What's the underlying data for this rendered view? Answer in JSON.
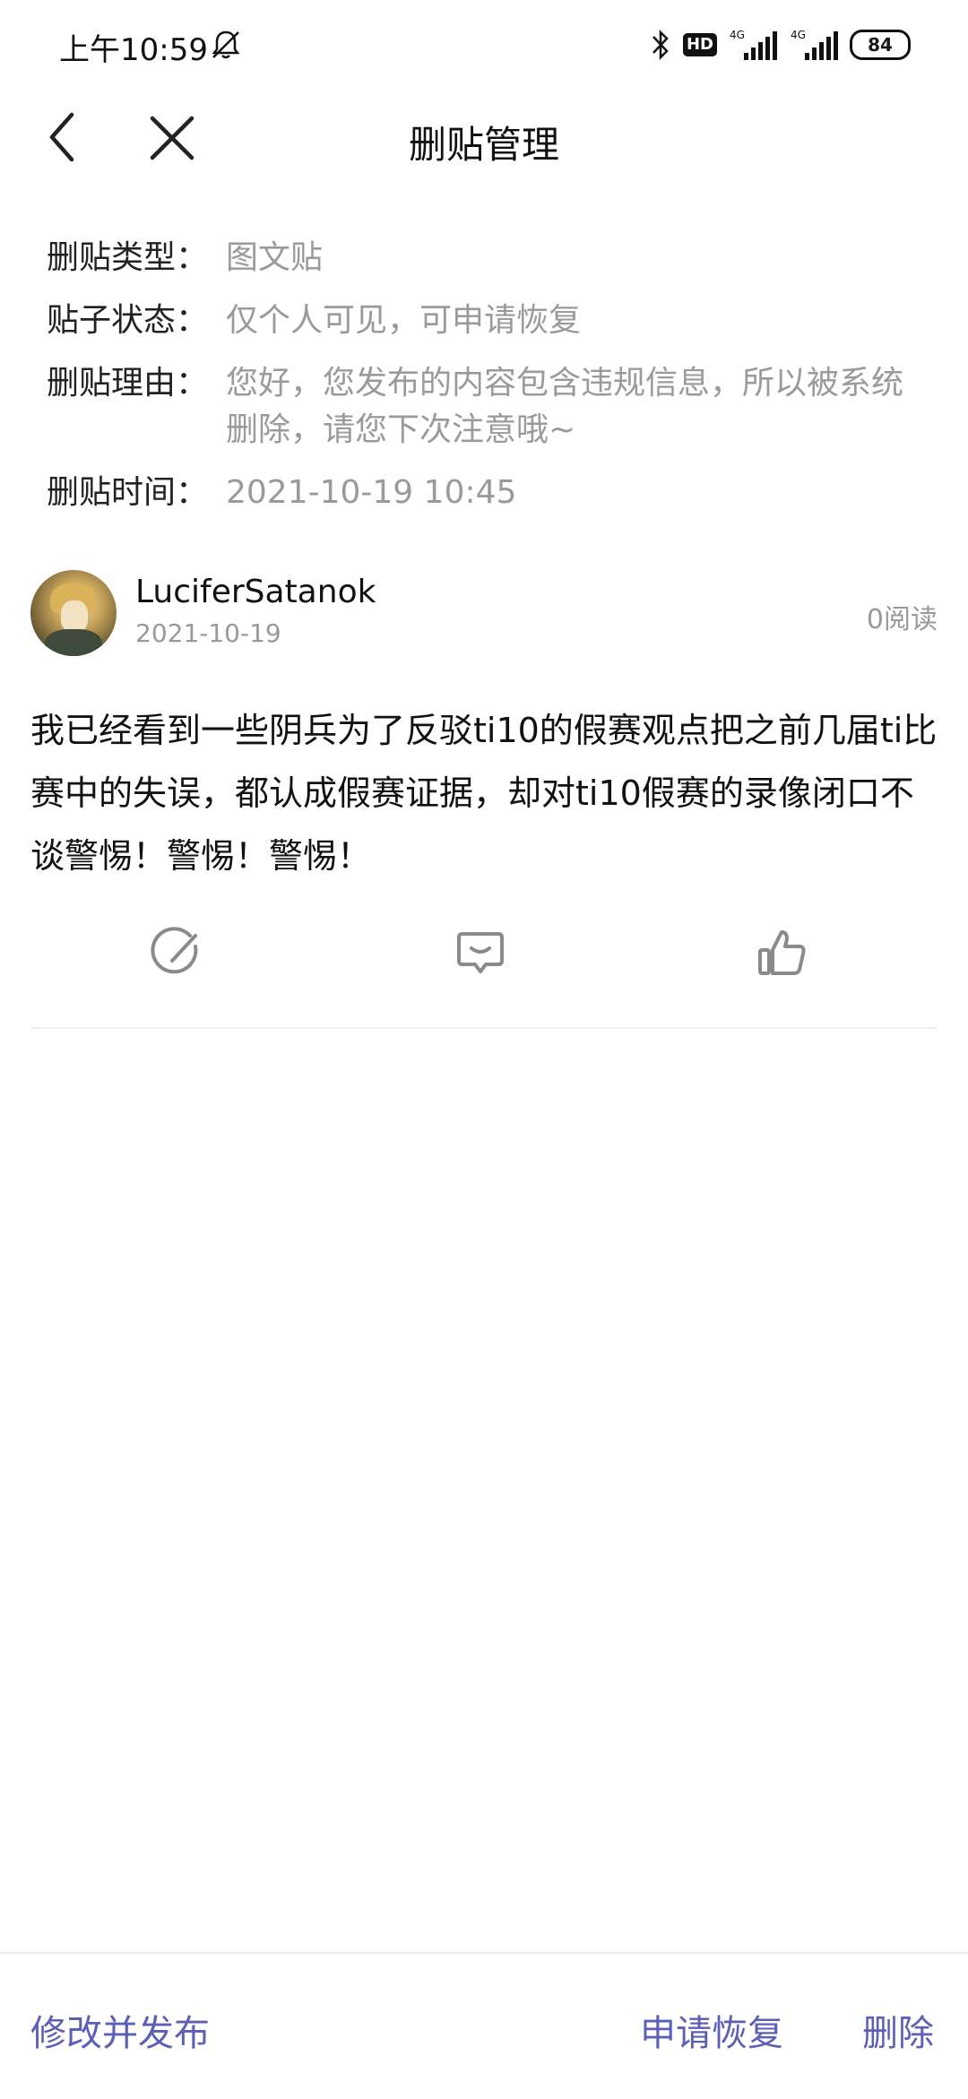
{
  "status_bar": {
    "time": "上午10:59",
    "hd_label": "HD",
    "network_1": "4G",
    "network_2": "4G",
    "battery": "84"
  },
  "navbar": {
    "title": "删贴管理",
    "back_icon": "chevron-left",
    "close_icon": "close-x"
  },
  "info": {
    "rows": [
      {
        "label": "删贴类型：",
        "value": "图文贴"
      },
      {
        "label": "贴子状态：",
        "value": "仅个人可见，可申请恢复"
      },
      {
        "label": "删贴理由：",
        "value": "您好，您发布的内容包含违规信息，所以被系统删除，请您下次注意哦~"
      },
      {
        "label": "删贴时间：",
        "value": "2021-10-19 10:45"
      }
    ]
  },
  "post": {
    "username": "LuciferSatanok",
    "date": "2021-10-19",
    "read_count": "0阅读",
    "content": "我已经看到一些阴兵为了反驳ti10的假赛观点把之前几届ti比赛中的失误，都认成假赛证据，却对ti10假赛的录像闭口不谈警惕！警惕！警惕！"
  },
  "bottom_bar": {
    "edit_publish": "修改并发布",
    "request_restore": "申请恢复",
    "delete": "删除"
  },
  "colors": {
    "accent": "#5b5fb5",
    "muted_text": "#9a9a9a"
  }
}
